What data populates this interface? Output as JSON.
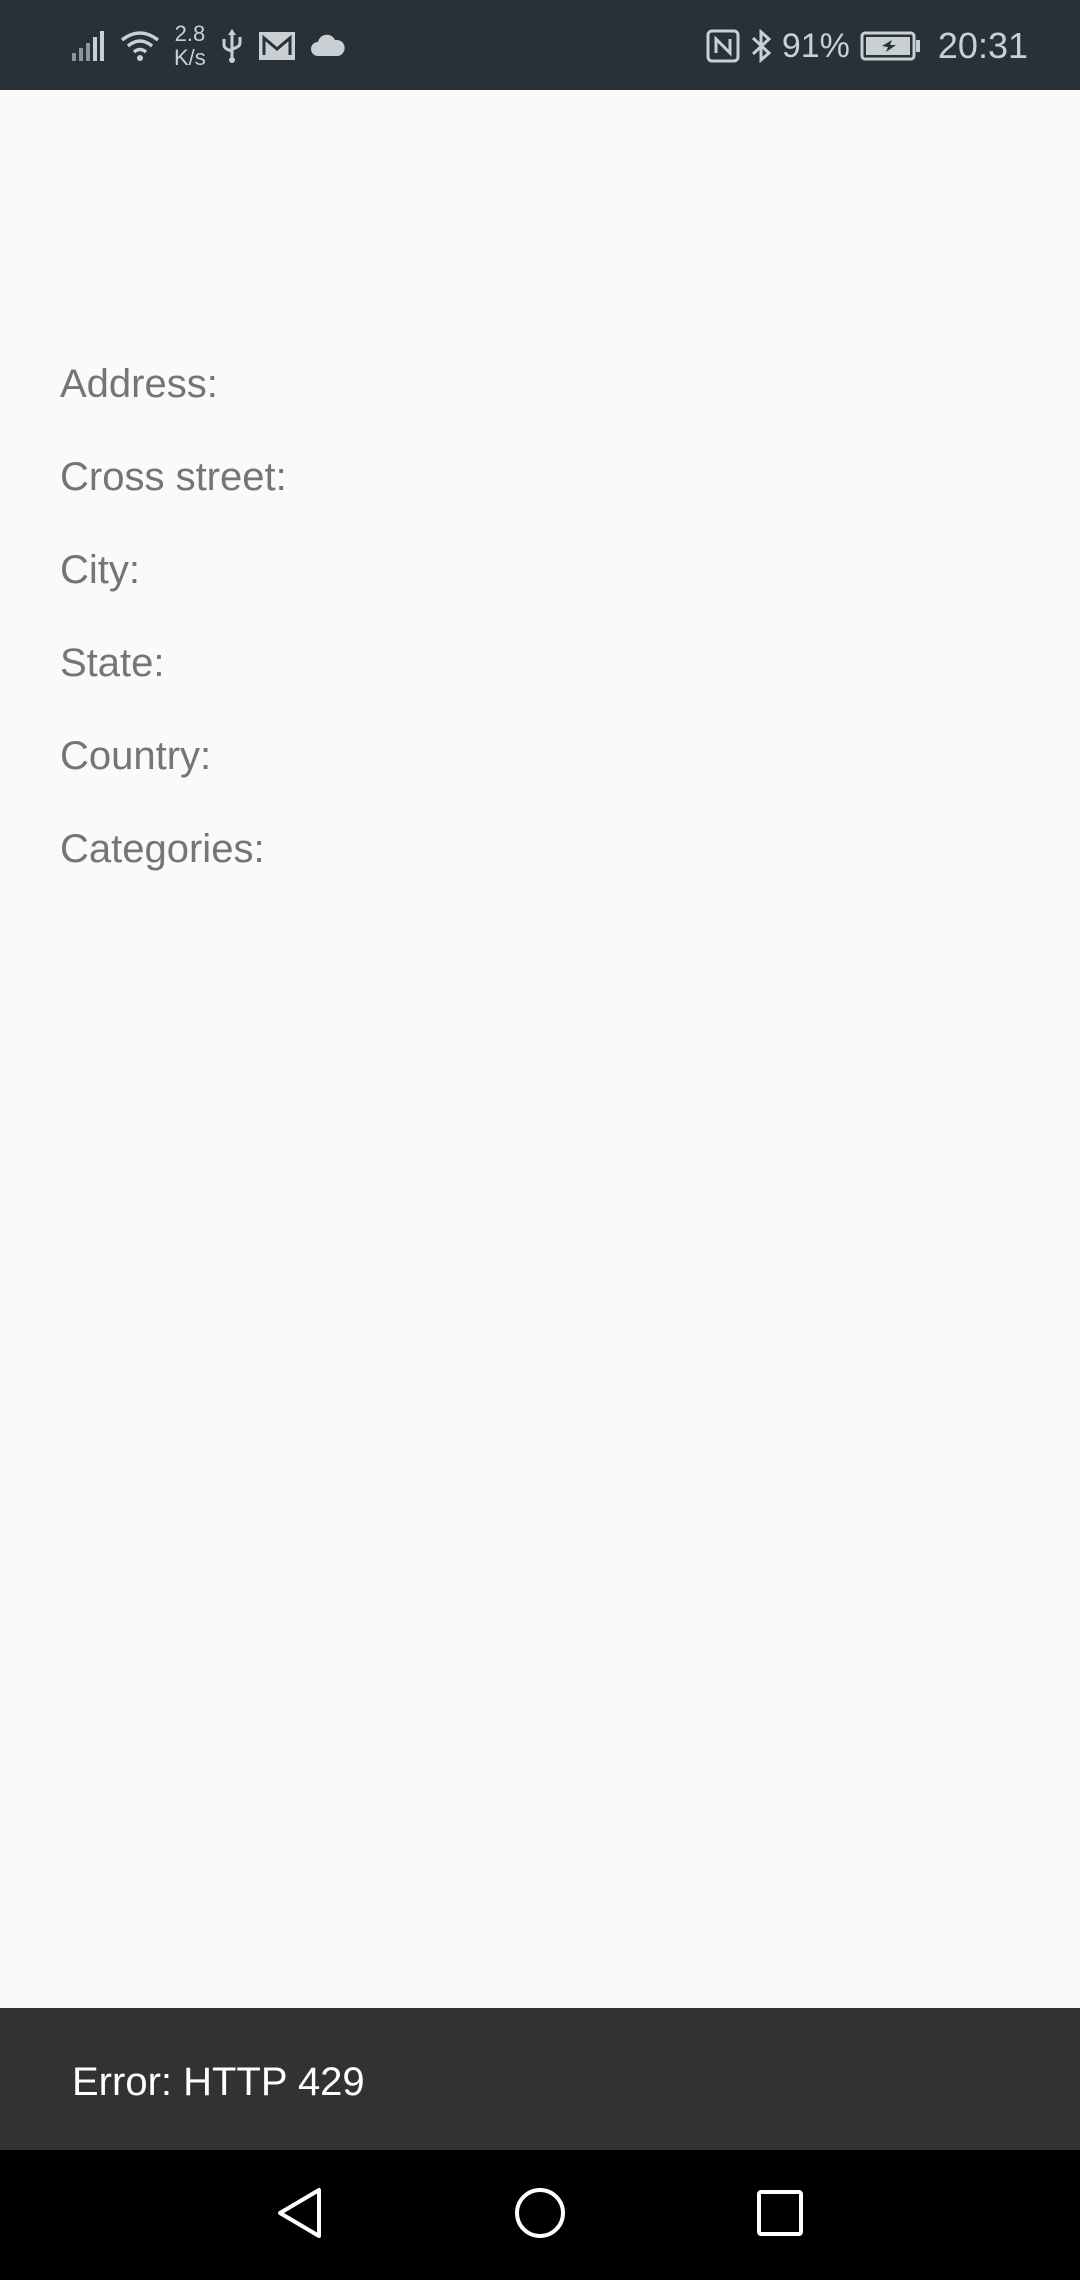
{
  "status_bar": {
    "net_speed_value": "2.8",
    "net_speed_unit": "K/s",
    "battery_percent": "91%",
    "time": "20:31",
    "icons": [
      "signal-icon",
      "wifi-icon",
      "usb-icon",
      "mail-icon",
      "cloud-icon",
      "nfc-icon",
      "bluetooth-icon",
      "battery-charging-icon"
    ]
  },
  "fields": {
    "address": "Address:",
    "cross_street": "Cross street:",
    "city": "City:",
    "state": "State:",
    "country": "Country:",
    "categories": "Categories:"
  },
  "snackbar": {
    "message": "Error: HTTP 429"
  },
  "nav_bar": {
    "icons": [
      "back-icon",
      "home-icon",
      "recents-icon"
    ]
  },
  "colors": {
    "status_bar": "#263238",
    "background": "#fafafa",
    "label_text": "#757575",
    "snackbar": "#323232",
    "nav_bar": "#000000"
  }
}
